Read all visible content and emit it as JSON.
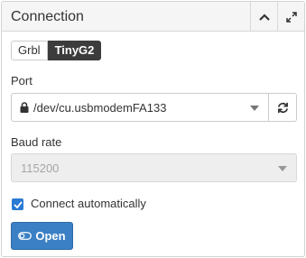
{
  "panel": {
    "title": "Connection",
    "collapse_icon": "chevron-up-icon",
    "expand_icon": "expand-icon"
  },
  "tabs": [
    {
      "label": "Grbl",
      "active": false
    },
    {
      "label": "TinyG2",
      "active": true
    }
  ],
  "port": {
    "label": "Port",
    "value": "/dev/cu.usbmodemFA133",
    "lock_icon": "lock-icon",
    "refresh_icon": "refresh-icon"
  },
  "baud": {
    "label": "Baud rate",
    "value": "115200",
    "disabled": true
  },
  "auto_connect": {
    "label": "Connect automatically",
    "checked": true
  },
  "open_button": {
    "label": "Open",
    "icon": "toggle-icon"
  },
  "colors": {
    "accent": "#3b80c4",
    "checkbox": "#2a7ad4",
    "active_tab": "#3c3c3c"
  }
}
